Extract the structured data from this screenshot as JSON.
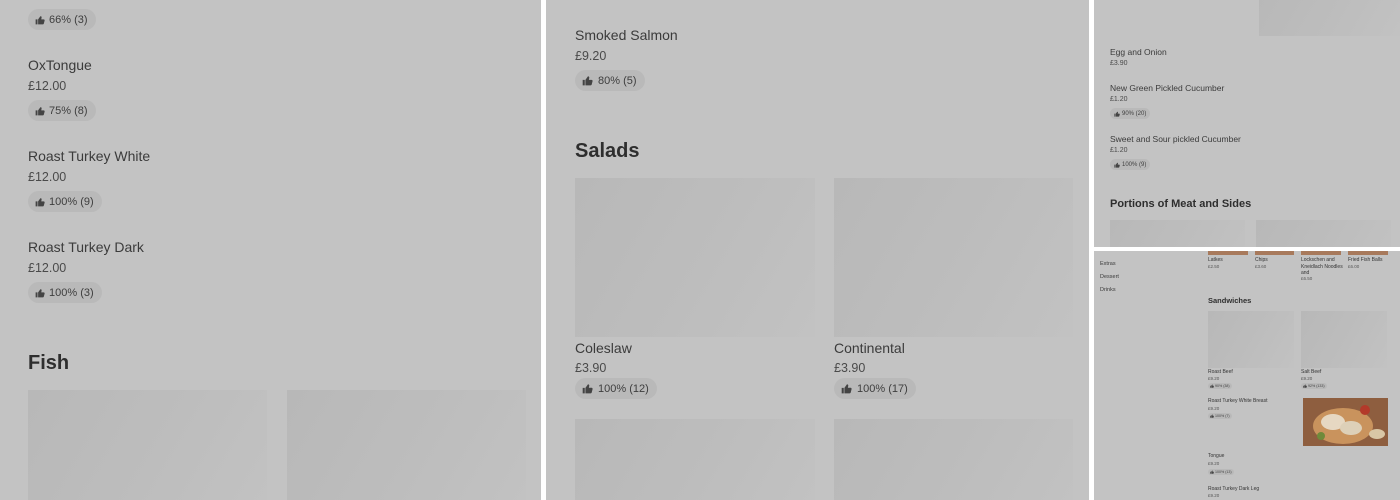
{
  "panel1": {
    "items": [
      {
        "name": "",
        "price": "",
        "rating": "66% (3)"
      },
      {
        "name": "OxTongue",
        "price": "£12.00",
        "rating": "75% (8)"
      },
      {
        "name": "Roast Turkey White",
        "price": "£12.00",
        "rating": "100% (9)"
      },
      {
        "name": "Roast Turkey Dark",
        "price": "£12.00",
        "rating": "100% (3)"
      }
    ],
    "section_title": "Fish"
  },
  "panel2": {
    "top_item": {
      "name": "Smoked Salmon",
      "price": "£9.20",
      "rating": "80% (5)"
    },
    "section_title": "Salads",
    "cards": [
      {
        "name": "Coleslaw",
        "price": "£3.90",
        "rating": "100% (12)"
      },
      {
        "name": "Continental",
        "price": "£3.90",
        "rating": "100% (17)"
      }
    ]
  },
  "panel3": {
    "items": [
      {
        "name": "Egg and Onion",
        "price": "£3.90",
        "rating": ""
      },
      {
        "name": "New Green Pickled Cucumber",
        "price": "£1.20",
        "rating": "90% (20)"
      },
      {
        "name": "Sweet and Sour pickled Cucumber",
        "price": "£1.20",
        "rating": "100% (9)"
      }
    ],
    "section_title": "Portions of Meat and Sides"
  },
  "panel4": {
    "nav": [
      "Extras",
      "Dessert",
      "Drinks"
    ],
    "sides": [
      {
        "name": "Latkes",
        "price": "£2.50"
      },
      {
        "name": "Chips",
        "price": "£3.60"
      },
      {
        "name": "Lockschen and Kneidlach Noodles and",
        "price": "£6.50"
      },
      {
        "name": "Fried Fish Balls",
        "price": "£6.00"
      }
    ],
    "section_title": "Sandwiches",
    "sandwich_cards": [
      {
        "name": "Roast Beef",
        "price": "£9.20",
        "rating": "90% (38)"
      },
      {
        "name": "Salt Beef",
        "price": "£9.20",
        "rating": "92% (133)"
      }
    ],
    "list": [
      {
        "name": "Roast Turkey White Breast",
        "price": "£9.20",
        "rating": "100% (7)"
      },
      {
        "name": "Tongue",
        "price": "£9.20",
        "rating": "100% (13)"
      },
      {
        "name": "Roast Turkey Dark Leg",
        "price": "£9.20",
        "rating": ""
      }
    ]
  }
}
